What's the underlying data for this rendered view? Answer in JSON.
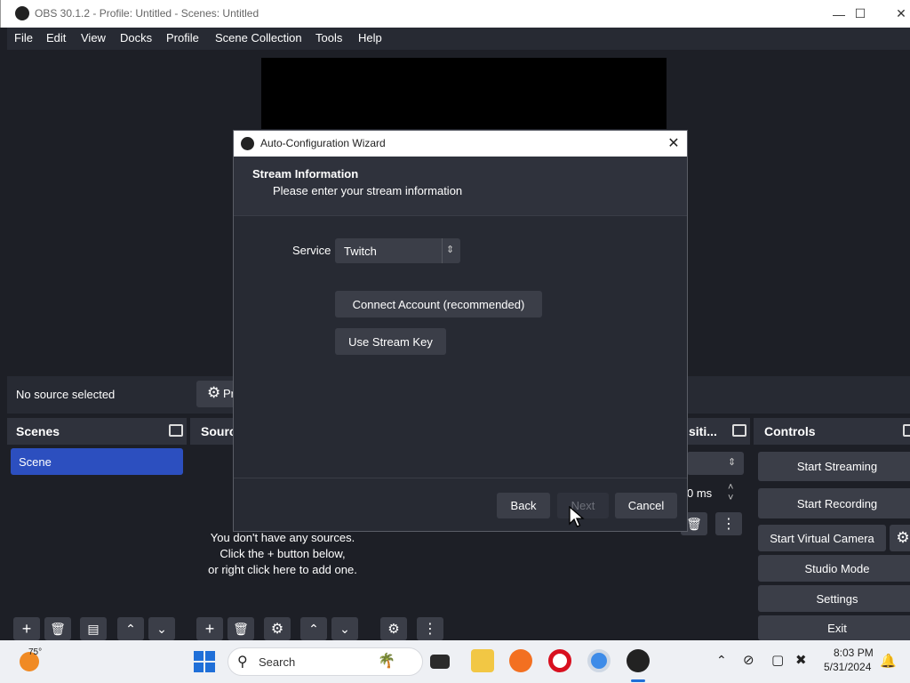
{
  "window": {
    "title": "OBS 30.1.2 - Profile: Untitled - Scenes: Untitled",
    "minimize_icon": "minimize-icon",
    "maximize_icon": "maximize-icon",
    "close_icon": "close-icon"
  },
  "menu": [
    "File",
    "Edit",
    "View",
    "Docks",
    "Profile",
    "Scene Collection",
    "Tools",
    "Help"
  ],
  "source_bar": {
    "status": "No source selected",
    "properties_label": "Pr"
  },
  "docks": {
    "scenes": {
      "title": "Scenes",
      "items": [
        "Scene"
      ]
    },
    "sources": {
      "title": "Sourc",
      "empty_line1": "You don't have any sources.",
      "empty_line2": "Click the + button below,",
      "empty_line3": "or right click here to add one."
    },
    "transitions": {
      "title": "siti...",
      "duration": "0 ms"
    },
    "controls": {
      "title": "Controls",
      "buttons": [
        "Start Streaming",
        "Start Recording",
        "Start Virtual Camera",
        "Studio Mode",
        "Settings",
        "Exit"
      ]
    }
  },
  "wizard": {
    "title": "Auto-Configuration Wizard",
    "header_title": "Stream Information",
    "header_subtitle": "Please enter your stream information",
    "service_label": "Service",
    "service_value": "Twitch",
    "connect_button": "Connect Account (recommended)",
    "stream_key_button": "Use Stream Key",
    "back_button": "Back",
    "next_button": "Next",
    "cancel_button": "Cancel"
  },
  "taskbar": {
    "weather_temp": "75°",
    "search_placeholder": "Search",
    "time": "8:03 PM",
    "date": "5/31/2024"
  },
  "colors": {
    "accent": "#2c4fbf",
    "panel": "#272a33",
    "background": "#1d1f26",
    "button": "#3b3e48"
  }
}
